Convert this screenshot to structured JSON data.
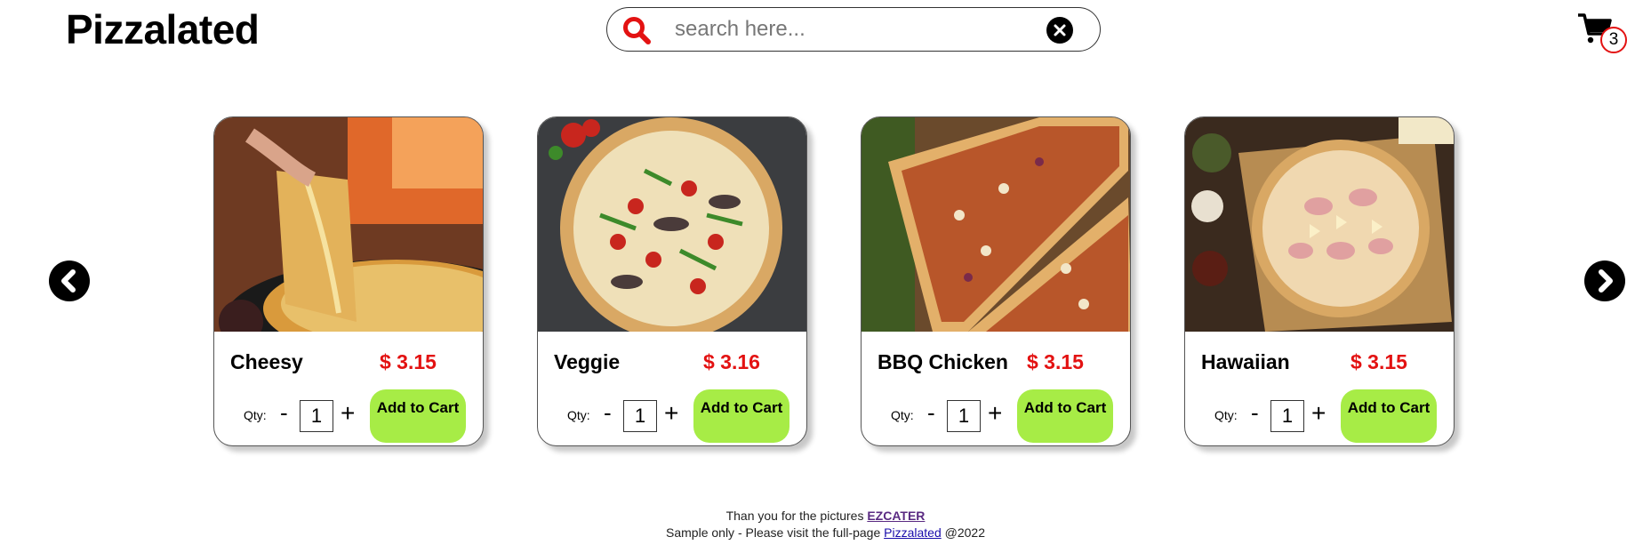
{
  "brand": "Pizzalated",
  "search": {
    "placeholder": "search here...",
    "icon": "search-icon",
    "clear_icon": "close-icon"
  },
  "cart": {
    "icon": "shopping-cart-icon",
    "count": "3"
  },
  "carousel": {
    "prev_icon": "chevron-left-icon",
    "next_icon": "chevron-right-icon"
  },
  "products": [
    {
      "name": "Cheesy",
      "price": "$ 3.15",
      "qty_label": "Qty:",
      "minus": "-",
      "qty": "1",
      "plus": "+",
      "button": "Add to Cart"
    },
    {
      "name": "Veggie",
      "price": "$ 3.16",
      "qty_label": "Qty:",
      "minus": "-",
      "qty": "1",
      "plus": "+",
      "button": "Add to Cart"
    },
    {
      "name": "BBQ Chicken",
      "price": "$ 3.15",
      "qty_label": "Qty:",
      "minus": "-",
      "qty": "1",
      "plus": "+",
      "button": "Add to Cart"
    },
    {
      "name": "Hawaiian",
      "price": "$ 3.15",
      "qty_label": "Qty:",
      "minus": "-",
      "qty": "1",
      "plus": "+",
      "button": "Add to Cart"
    }
  ],
  "footer": {
    "line1_text": "Than you for the pictures",
    "line1_link": "EZCATER",
    "line2_text": "Sample only - Please visit the full-page",
    "line2_link": "Pizzalated",
    "line2_suffix": "@2022"
  },
  "colors": {
    "price": "#e31212",
    "button": "#a7ec46",
    "search_icon": "#e31212",
    "cart_badge_border": "#e31212"
  }
}
